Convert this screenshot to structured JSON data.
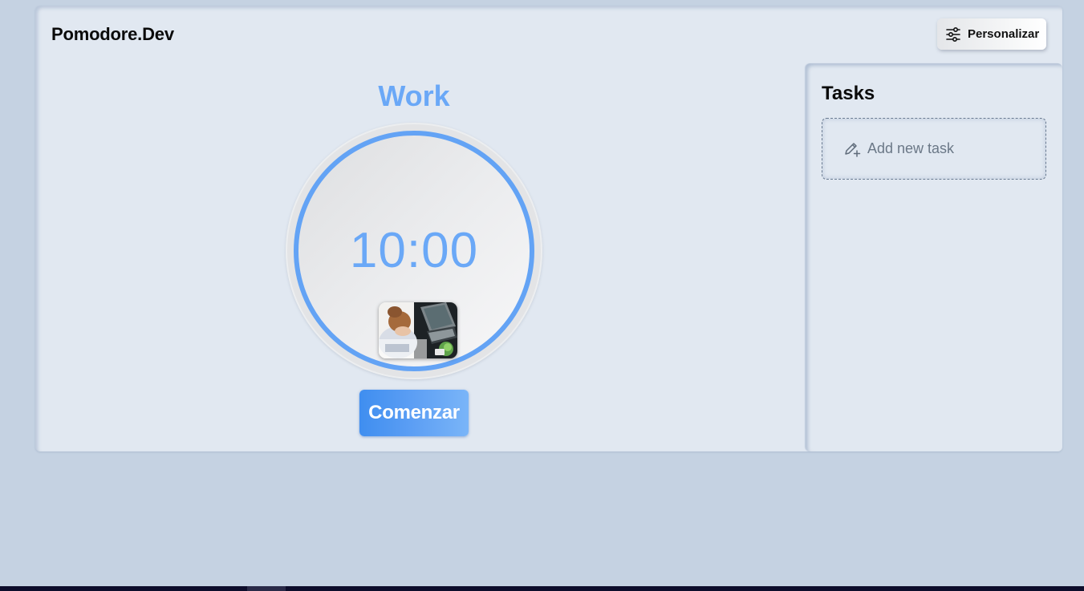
{
  "app": {
    "brand": "Pomodore.Dev",
    "customize_label": "Personalizar",
    "customize_icon": "sliders-icon"
  },
  "timer": {
    "mode": "Work",
    "time": "10:00",
    "ring_color": "#63a3f5",
    "progress": 1.0,
    "image": "person-at-laptop-photo"
  },
  "controls": {
    "start_label": "Comenzar"
  },
  "tasks": {
    "title": "Tasks",
    "add_label": "Add new task",
    "add_icon": "pencil-plus-icon",
    "items": []
  },
  "colors": {
    "accent": "#6aa8f7",
    "background": "#c5d2e2",
    "card": "#e1e8f1"
  }
}
